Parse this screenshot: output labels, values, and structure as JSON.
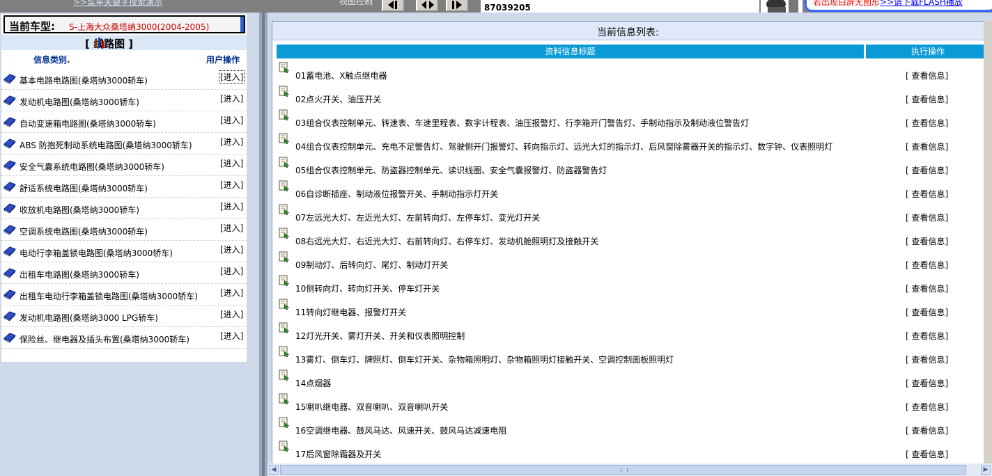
{
  "topbar": {
    "menu_link": ">>菜单关键字搜索演示",
    "view_label": "视图控制",
    "phone": "87039205",
    "flash_text": "若出现白屏无图形",
    "flash_link": ">>请下载FLASH播放"
  },
  "left": {
    "car_label": "当前车型:",
    "car_value": "S-上海大众桑塔纳3000(2004-2005)",
    "category_title": "[      线路图  ]",
    "col_type": "信息类别.",
    "col_action": "用户操作",
    "enter_label": "[进入]",
    "items": [
      {
        "label": "基本电路电路图(桑塔纳3000轿车)"
      },
      {
        "label": "发动机电路图(桑塔纳3000轿车)"
      },
      {
        "label": "自动变速箱电路图(桑塔纳3000轿车)"
      },
      {
        "label": "ABS 防抱死制动系统电路图(桑塔纳3000轿车)"
      },
      {
        "label": "安全气囊系统电路图(桑塔纳3000轿车)"
      },
      {
        "label": "舒适系统电路图(桑塔纳3000轿车)"
      },
      {
        "label": "收放机电路图(桑塔纳3000轿车)"
      },
      {
        "label": "空调系统电路图(桑塔纳3000轿车)"
      },
      {
        "label": "电动行李箱盖锁电路图(桑塔纳3000轿车)"
      },
      {
        "label": "出租车电路图(桑塔纳3000轿车)"
      },
      {
        "label": "出租车电动行李箱盖锁电路图(桑塔纳3000轿车)"
      },
      {
        "label": "发动机电路图(桑塔纳3000 LPG轿车)"
      },
      {
        "label": "保险丝、继电器及插头布置(桑塔纳3000轿车)"
      }
    ]
  },
  "right": {
    "list_title": "当前信息列表:",
    "col_title": "资料信息标题",
    "col_action": "执行操作",
    "action_label": "[ 查看信息]",
    "rows": [
      {
        "title": "01蓄电池、X触点继电器"
      },
      {
        "title": "02点火开关、油压开关"
      },
      {
        "title": "03组合仪表控制单元、转速表、车速里程表、数字计程表、油压报警灯、行李箱开门警告灯、手制动指示及制动液位警告灯"
      },
      {
        "title": "04组合仪表控制单元、充电不足警告灯、驾驶侧开门报警灯、转向指示灯、远光大灯的指示灯、后风窗除雾器开关的指示灯、数字钟、仪表照明灯"
      },
      {
        "title": "05组合仪表控制单元、防盗器控制单元、读识线圈、安全气囊报警灯、防盗器警告灯"
      },
      {
        "title": "06自诊断插座、制动液位报警开关、手制动指示灯开关"
      },
      {
        "title": "07左远光大灯、左近光大灯、左前转向灯、左停车灯、变光灯开关"
      },
      {
        "title": "08右远光大灯、右近光大灯、右前转向灯、右停车灯、发动机舱照明灯及接触开关"
      },
      {
        "title": "09制动灯、后转向灯、尾灯、制动灯开关"
      },
      {
        "title": "10侧转向灯、转向灯开关、停车灯开关"
      },
      {
        "title": "11转向灯继电器、报警灯开关"
      },
      {
        "title": "12灯光开关、雾灯开关、开关和仪表照明控制"
      },
      {
        "title": "13雾灯、倒车灯、牌照灯、倒车灯开关、杂物箱照明灯、杂物箱照明灯接触开关、空调控制面板照明灯"
      },
      {
        "title": "14点烟器"
      },
      {
        "title": "15喇叭继电器、双音喇叭、双音喇叭开关"
      },
      {
        "title": "16空调继电器、鼓风马达、风速开关、鼓风马达减速电阻"
      },
      {
        "title": "17后风窗除霜器及开关"
      }
    ]
  },
  "colors": {
    "header_blue": "#0a9ad6",
    "panel_bg": "#ced9e9",
    "car_value_red": "#cc0000",
    "col_header_blue": "#002f8e"
  }
}
